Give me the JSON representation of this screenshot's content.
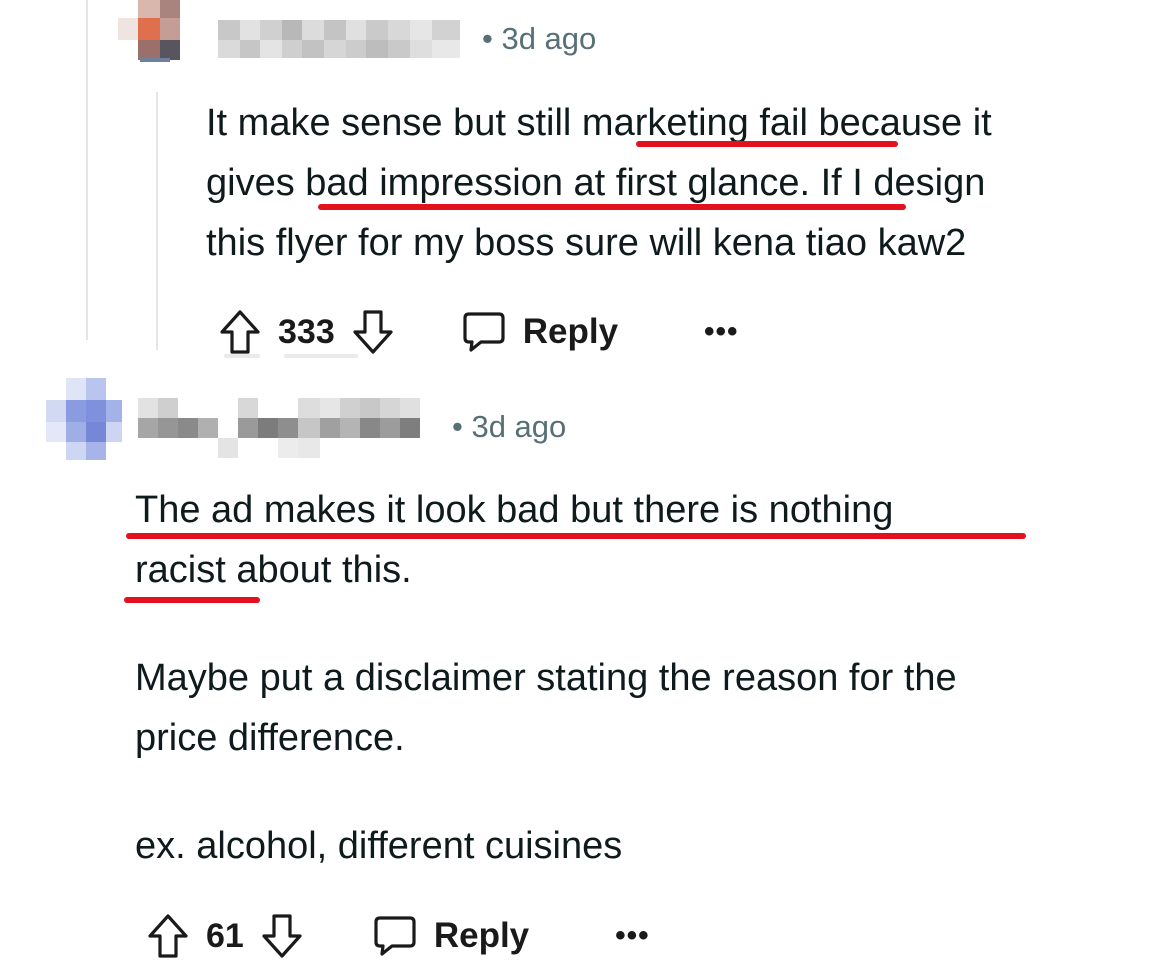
{
  "comments": [
    {
      "time": "• 3d ago",
      "body_lines": [
        "It make sense but still marketing fail because it",
        "gives bad impression at first glance. If I design",
        "this flyer for my boss sure will kena tiao kaw2"
      ],
      "score": "333",
      "reply_label": "Reply",
      "more_label": "•••"
    },
    {
      "time": "• 3d ago",
      "paragraphs": [
        [
          "The ad makes it look bad but there is nothing",
          "racist about this."
        ],
        [
          "Maybe put a disclaimer stating the reason for the",
          "price difference."
        ],
        [
          "ex. alcohol, different cuisines"
        ]
      ],
      "score": "61",
      "reply_label": "Reply",
      "more_label": "•••"
    }
  ],
  "colors": {
    "highlight_underline": "#e3101d",
    "meta_text": "#576f76",
    "thread_line": "#e3e6e8"
  },
  "icons": {
    "upvote": "arrow-up-icon",
    "downvote": "arrow-down-icon",
    "reply": "speech-bubble-icon",
    "more": "ellipsis-icon"
  }
}
